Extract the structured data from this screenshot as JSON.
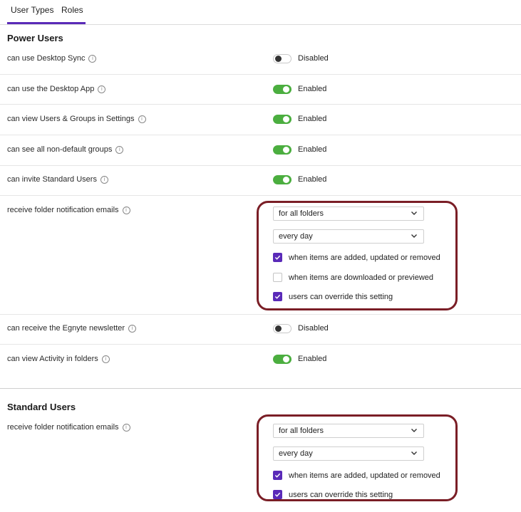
{
  "tabs": [
    {
      "label": "User Types",
      "active": true
    },
    {
      "label": "Roles",
      "active": false
    }
  ],
  "colors": {
    "accent": "#5a2ab8",
    "toggle_on": "#4bae3f",
    "highlight": "#7a1e26"
  },
  "power_users": {
    "title": "Power Users",
    "settings": [
      {
        "label": "can use Desktop Sync",
        "state": "off",
        "status": "Disabled"
      },
      {
        "label": "can use the Desktop App",
        "state": "on",
        "status": "Enabled"
      },
      {
        "label": "can view Users & Groups in Settings",
        "state": "on",
        "status": "Enabled"
      },
      {
        "label": "can see all non-default groups",
        "state": "on",
        "status": "Enabled"
      },
      {
        "label": "can invite Standard Users",
        "state": "on",
        "status": "Enabled"
      },
      {
        "label": "receive folder notification emails"
      },
      {
        "label": "can receive the Egnyte newsletter",
        "state": "off",
        "status": "Disabled"
      },
      {
        "label": "can view Activity in folders",
        "state": "on",
        "status": "Enabled"
      }
    ],
    "notifications": {
      "folders_select": "for all folders",
      "frequency_select": "every day",
      "options": [
        {
          "label": "when items are added, updated or removed",
          "checked": true
        },
        {
          "label": "when items are downloaded or previewed",
          "checked": false
        },
        {
          "label": "users can override this setting",
          "checked": true
        }
      ]
    }
  },
  "standard_users": {
    "title": "Standard Users",
    "settings": [
      {
        "label": "receive folder notification emails"
      }
    ],
    "notifications": {
      "folders_select": "for all folders",
      "frequency_select": "every day",
      "options": [
        {
          "label": "when items are added, updated or removed",
          "checked": true
        },
        {
          "label": "users can override this setting",
          "checked": true
        }
      ]
    }
  }
}
